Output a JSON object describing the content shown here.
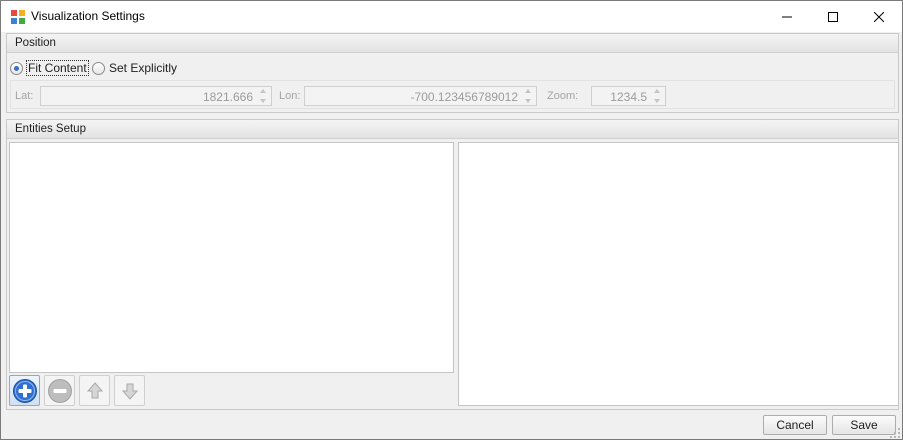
{
  "window": {
    "title": "Visualization Settings",
    "icon": "app-tiles-icon",
    "controls": [
      "minimize-icon",
      "maximize-icon",
      "close-icon"
    ]
  },
  "position": {
    "header": "Position",
    "modes": [
      {
        "label": "Fit Content",
        "checked": true
      },
      {
        "label": "Set Explicitly",
        "checked": false
      }
    ],
    "lat": {
      "label": "Lat:",
      "value": "1821.666"
    },
    "lon": {
      "label": "Lon:",
      "value": "-700.123456789012"
    },
    "zoom": {
      "label": "Zoom:",
      "value": "1234.5"
    }
  },
  "entities": {
    "header": "Entities Setup",
    "toolbar": [
      "add-icon",
      "remove-icon",
      "arrow-up-icon",
      "arrow-down-icon"
    ]
  },
  "footer": {
    "cancel_label": "Cancel",
    "save_label": "Save"
  },
  "colors": {
    "accent": "#3a6fc4",
    "add_button": "#2f6fd3",
    "disabled_text": "#9b9b9b"
  }
}
